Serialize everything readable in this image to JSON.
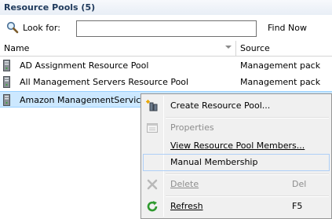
{
  "panel": {
    "title": "Resource Pools (5)"
  },
  "search": {
    "label": "Look for:",
    "value": "",
    "find_label": "Find Now"
  },
  "columns": {
    "name": "Name",
    "source": "Source"
  },
  "rows": [
    {
      "name": "AD Assignment Resource Pool",
      "source": "Management pack"
    },
    {
      "name": "All Management Servers Resource Pool",
      "source": "Management pack"
    },
    {
      "name": "Amazon ManagementService",
      "source": ""
    }
  ],
  "context_menu": {
    "items": [
      {
        "label": "Create Resource Pool...",
        "key": ""
      },
      {
        "label": "Properties",
        "key": ""
      },
      {
        "label": "View Resource Pool Members...",
        "key": ""
      },
      {
        "label": "Manual Membership",
        "key": ""
      },
      {
        "label": "Delete",
        "key": "Del"
      },
      {
        "label": "Refresh",
        "key": "F5"
      }
    ]
  },
  "colors": {
    "selection": "#cce8ff",
    "title_text": "#1e395b",
    "hover_border": "#aecff7"
  }
}
